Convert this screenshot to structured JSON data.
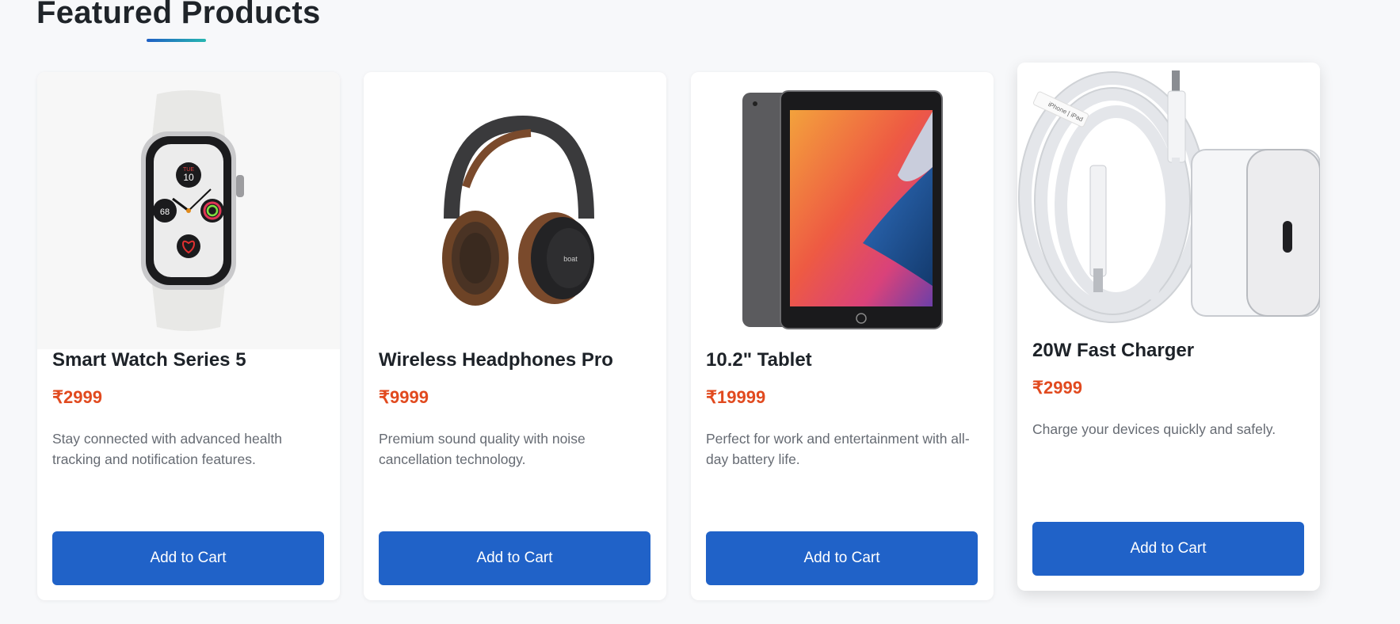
{
  "section": {
    "title": "Featured Products"
  },
  "products": [
    {
      "name": "Smart Watch Series 5",
      "price": "₹2999",
      "description": "Stay connected with advanced health tracking and notification features.",
      "button": "Add to Cart",
      "image_icon": "smartwatch-image"
    },
    {
      "name": "Wireless Headphones Pro",
      "price": "₹9999",
      "description": "Premium sound quality with noise cancellation technology.",
      "button": "Add to Cart",
      "image_icon": "headphones-image"
    },
    {
      "name": "10.2\" Tablet",
      "price": "₹19999",
      "description": "Perfect for work and entertainment with all-day battery life.",
      "button": "Add to Cart",
      "image_icon": "tablet-image"
    },
    {
      "name": "20W Fast Charger",
      "price": "₹2999",
      "description": "Charge your devices quickly and safely.",
      "button": "Add to Cart",
      "image_icon": "charger-image"
    }
  ],
  "colors": {
    "price": "#e14a1f",
    "button": "#2062c8",
    "title": "#1f2429",
    "background": "#f7f8fa"
  }
}
